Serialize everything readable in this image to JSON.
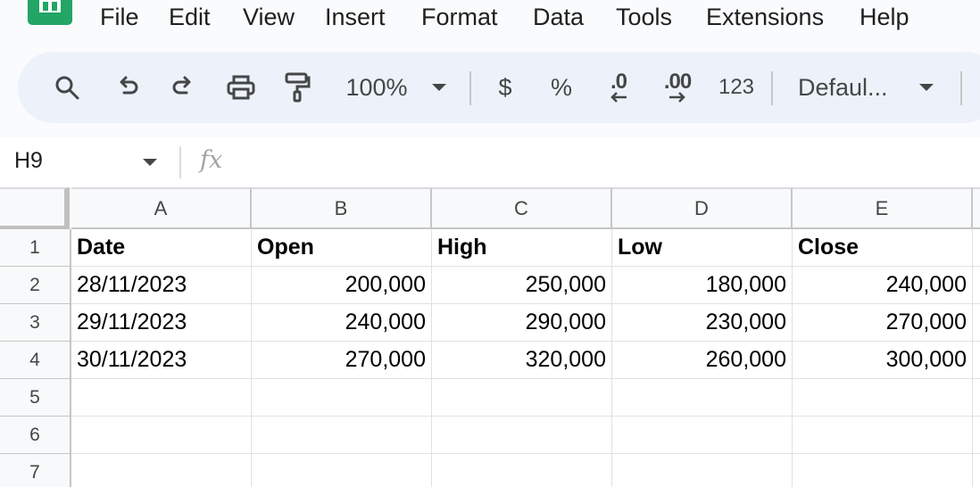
{
  "menu": {
    "items": [
      "File",
      "Edit",
      "View",
      "Insert",
      "Format",
      "Data",
      "Tools",
      "Extensions",
      "Help"
    ]
  },
  "toolbar": {
    "icons": [
      "search-icon",
      "undo-icon",
      "redo-icon",
      "print-icon",
      "paint-format-icon"
    ],
    "zoom": "100%",
    "currency_label": "$",
    "percent_label": "%",
    "decrease_decimal_label": ".0",
    "increase_decimal_label": ".00",
    "more_formats_label": "123",
    "font_label": "Defaul..."
  },
  "formula_bar": {
    "name_box": "H9",
    "fx_label": "fx",
    "value": ""
  },
  "sheet": {
    "columns": [
      "A",
      "B",
      "C",
      "D",
      "E"
    ],
    "rows": [
      "1",
      "2",
      "3",
      "4",
      "5",
      "6",
      "7"
    ],
    "header": [
      "Date",
      "Open",
      "High",
      "Low",
      "Close"
    ],
    "data": [
      [
        "28/11/2023",
        "200,000",
        "250,000",
        "180,000",
        "240,000"
      ],
      [
        "29/11/2023",
        "240,000",
        "290,000",
        "230,000",
        "270,000"
      ],
      [
        "30/11/2023",
        "270,000",
        "320,000",
        "260,000",
        "300,000"
      ]
    ]
  },
  "colors": {
    "brand": "#22a565",
    "toolbar_bg": "#edf2fa",
    "chrome_bg": "#f9fbfd",
    "header_bg": "#f8f9fa"
  }
}
